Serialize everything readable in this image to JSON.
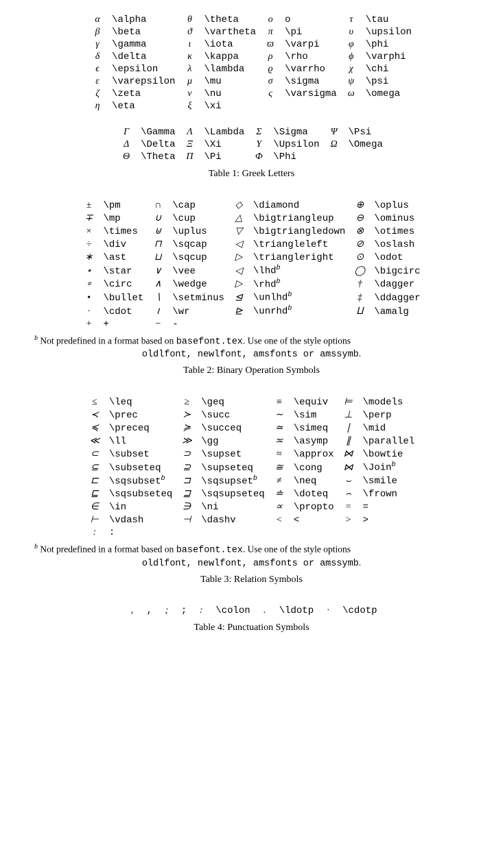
{
  "tables": [
    {
      "caption": "Table 1: Greek Letters",
      "footnote": null,
      "groups": [
        {
          "cols": 4,
          "rows": [
            [
              [
                "α",
                "\\alpha"
              ],
              [
                "θ",
                "\\theta"
              ],
              [
                "o",
                "o"
              ],
              [
                "τ",
                "\\tau"
              ]
            ],
            [
              [
                "β",
                "\\beta"
              ],
              [
                "ϑ",
                "\\vartheta"
              ],
              [
                "π",
                "\\pi"
              ],
              [
                "υ",
                "\\upsilon"
              ]
            ],
            [
              [
                "γ",
                "\\gamma"
              ],
              [
                "ι",
                "\\iota"
              ],
              [
                "ϖ",
                "\\varpi"
              ],
              [
                "φ",
                "\\phi"
              ]
            ],
            [
              [
                "δ",
                "\\delta"
              ],
              [
                "κ",
                "\\kappa"
              ],
              [
                "ρ",
                "\\rho"
              ],
              [
                "ϕ",
                "\\varphi"
              ]
            ],
            [
              [
                "ϵ",
                "\\epsilon"
              ],
              [
                "λ",
                "\\lambda"
              ],
              [
                "ϱ",
                "\\varrho"
              ],
              [
                "χ",
                "\\chi"
              ]
            ],
            [
              [
                "ε",
                "\\varepsilon"
              ],
              [
                "μ",
                "\\mu"
              ],
              [
                "σ",
                "\\sigma"
              ],
              [
                "ψ",
                "\\psi"
              ]
            ],
            [
              [
                "ζ",
                "\\zeta"
              ],
              [
                "ν",
                "\\nu"
              ],
              [
                "ς",
                "\\varsigma"
              ],
              [
                "ω",
                "\\omega"
              ]
            ],
            [
              [
                "η",
                "\\eta"
              ],
              [
                "ξ",
                "\\xi"
              ],
              [
                "",
                ""
              ],
              [
                "",
                ""
              ]
            ]
          ]
        },
        {
          "cols": 4,
          "rows": [
            [
              [
                "Γ",
                "\\Gamma"
              ],
              [
                "Λ",
                "\\Lambda"
              ],
              [
                "Σ",
                "\\Sigma"
              ],
              [
                "Ψ",
                "\\Psi"
              ]
            ],
            [
              [
                "Δ",
                "\\Delta"
              ],
              [
                "Ξ",
                "\\Xi"
              ],
              [
                "Υ",
                "\\Upsilon"
              ],
              [
                "Ω",
                "\\Omega"
              ]
            ],
            [
              [
                "Θ",
                "\\Theta"
              ],
              [
                "Π",
                "\\Pi"
              ],
              [
                "Φ",
                "\\Phi"
              ],
              [
                "",
                ""
              ]
            ]
          ]
        }
      ]
    },
    {
      "caption": "Table 2: Binary Operation Symbols",
      "footnote": {
        "marker": "b",
        "text_a": " Not predefined in a format based on ",
        "tt_a": "basefont.tex",
        "text_b": ". Use one of the style options ",
        "tt_list": "oldlfont, newlfont, amsfonts or amssymb",
        "text_c": "."
      },
      "groups": [
        {
          "cols": 4,
          "rows": [
            [
              [
                "±",
                "\\pm"
              ],
              [
                "∩",
                "\\cap"
              ],
              [
                "◇",
                "\\diamond"
              ],
              [
                "⊕",
                "\\oplus"
              ]
            ],
            [
              [
                "∓",
                "\\mp"
              ],
              [
                "∪",
                "\\cup"
              ],
              [
                "△",
                "\\bigtriangleup"
              ],
              [
                "⊖",
                "\\ominus"
              ]
            ],
            [
              [
                "×",
                "\\times"
              ],
              [
                "⊎",
                "\\uplus"
              ],
              [
                "▽",
                "\\bigtriangledown"
              ],
              [
                "⊗",
                "\\otimes"
              ]
            ],
            [
              [
                "÷",
                "\\div"
              ],
              [
                "⊓",
                "\\sqcap"
              ],
              [
                "◁",
                "\\triangleleft"
              ],
              [
                "⊘",
                "\\oslash"
              ]
            ],
            [
              [
                "∗",
                "\\ast"
              ],
              [
                "⊔",
                "\\sqcup"
              ],
              [
                "▷",
                "\\triangleright"
              ],
              [
                "⊙",
                "\\odot"
              ]
            ],
            [
              [
                "⋆",
                "\\star"
              ],
              [
                "∨",
                "\\vee"
              ],
              [
                "◁",
                "\\lhdᵇ"
              ],
              [
                "◯",
                "\\bigcirc"
              ]
            ],
            [
              [
                "∘",
                "\\circ"
              ],
              [
                "∧",
                "\\wedge"
              ],
              [
                "▷",
                "\\rhdᵇ"
              ],
              [
                "†",
                "\\dagger"
              ]
            ],
            [
              [
                "•",
                "\\bullet"
              ],
              [
                "∖",
                "\\setminus"
              ],
              [
                "⊴",
                "\\unlhdᵇ"
              ],
              [
                "‡",
                "\\ddagger"
              ]
            ],
            [
              [
                "·",
                "\\cdot"
              ],
              [
                "≀",
                "\\wr"
              ],
              [
                "⊵",
                "\\unrhdᵇ"
              ],
              [
                "⨿",
                "\\amalg"
              ]
            ],
            [
              [
                "+",
                "+"
              ],
              [
                "−",
                "-"
              ],
              [
                "",
                ""
              ],
              [
                "",
                ""
              ]
            ]
          ]
        }
      ]
    },
    {
      "caption": "Table 3: Relation Symbols",
      "footnote": {
        "marker": "b",
        "text_a": " Not predefined in a format based on ",
        "tt_a": "basefont.tex",
        "text_b": ". Use one of the style options ",
        "tt_list": "oldlfont, newlfont, amsfonts or amssymb",
        "text_c": "."
      },
      "groups": [
        {
          "cols": 4,
          "rows": [
            [
              [
                "≤",
                "\\leq"
              ],
              [
                "≥",
                "\\geq"
              ],
              [
                "≡",
                "\\equiv"
              ],
              [
                "⊨",
                "\\models"
              ]
            ],
            [
              [
                "≺",
                "\\prec"
              ],
              [
                "≻",
                "\\succ"
              ],
              [
                "∼",
                "\\sim"
              ],
              [
                "⊥",
                "\\perp"
              ]
            ],
            [
              [
                "≼",
                "\\preceq"
              ],
              [
                "≽",
                "\\succeq"
              ],
              [
                "≃",
                "\\simeq"
              ],
              [
                "∣",
                "\\mid"
              ]
            ],
            [
              [
                "≪",
                "\\ll"
              ],
              [
                "≫",
                "\\gg"
              ],
              [
                "≍",
                "\\asymp"
              ],
              [
                "∥",
                "\\parallel"
              ]
            ],
            [
              [
                "⊂",
                "\\subset"
              ],
              [
                "⊃",
                "\\supset"
              ],
              [
                "≈",
                "\\approx"
              ],
              [
                "⋈",
                "\\bowtie"
              ]
            ],
            [
              [
                "⊆",
                "\\subseteq"
              ],
              [
                "⊇",
                "\\supseteq"
              ],
              [
                "≅",
                "\\cong"
              ],
              [
                "⋈",
                "\\Joinᵇ"
              ]
            ],
            [
              [
                "⊏",
                "\\sqsubsetᵇ"
              ],
              [
                "⊐",
                "\\sqsupsetᵇ"
              ],
              [
                "≠",
                "\\neq"
              ],
              [
                "⌣",
                "\\smile"
              ]
            ],
            [
              [
                "⊑",
                "\\sqsubseteq"
              ],
              [
                "⊒",
                "\\sqsupseteq"
              ],
              [
                "≐",
                "\\doteq"
              ],
              [
                "⌢",
                "\\frown"
              ]
            ],
            [
              [
                "∈",
                "\\in"
              ],
              [
                "∋",
                "\\ni"
              ],
              [
                "∝",
                "\\propto"
              ],
              [
                "=",
                "="
              ]
            ],
            [
              [
                "⊢",
                "\\vdash"
              ],
              [
                "⊣",
                "\\dashv"
              ],
              [
                "<",
                "<"
              ],
              [
                ">",
                ">"
              ]
            ],
            [
              [
                ":",
                ":"
              ],
              [
                "",
                ""
              ],
              [
                "",
                ""
              ],
              [
                "",
                ""
              ]
            ]
          ]
        }
      ]
    },
    {
      "caption": "Table 4: Punctuation Symbols",
      "footnote": null,
      "groups": [
        {
          "cols": 5,
          "rows": [
            [
              [
                ",",
                " ,"
              ],
              [
                ";",
                " ;"
              ],
              [
                ":",
                "\\colon"
              ],
              [
                ".",
                "\\ldotp"
              ],
              [
                "·",
                "\\cdotp"
              ]
            ]
          ]
        }
      ]
    }
  ]
}
